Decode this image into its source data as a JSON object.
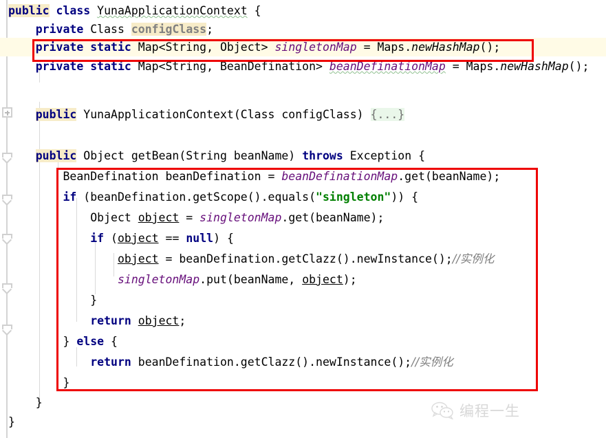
{
  "editor": {
    "language": "Java",
    "class_name": "YunaApplicationContext",
    "theme": {
      "background": "#ffffff",
      "text": "#000000",
      "keyword": "#000080",
      "string": "#008000",
      "field": "#660e7a",
      "comment": "#808080",
      "current_line_bg": "#fffbe6",
      "annotation_box": "#ee0000",
      "identifier_highlight": "#f7ecc8",
      "folded_code_bg": "#eaf7ea",
      "warning_squiggle": "#8fbf8f"
    }
  },
  "gutter": {
    "fold_expand_icon": "+",
    "fold_end_icons": 5
  },
  "code_lines": [
    {
      "n": 1,
      "indent": 0,
      "text": "public class YunaApplicationContext {"
    },
    {
      "n": 2,
      "indent": 1,
      "text": "private Class configClass;"
    },
    {
      "n": 3,
      "indent": 1,
      "text": "private static Map<String, Object> singletonMap = Maps.newHashMap();",
      "highlighted": true
    },
    {
      "n": 4,
      "indent": 1,
      "text": "private static Map<String, BeanDefination> beanDefinationMap = Maps.newHashMap();"
    },
    {
      "n": 5,
      "indent": 0,
      "text": ""
    },
    {
      "n": 6,
      "indent": 1,
      "text": "public YunaApplicationContext(Class configClass) {...}"
    },
    {
      "n": 7,
      "indent": 0,
      "text": ""
    },
    {
      "n": 8,
      "indent": 1,
      "text": "public Object getBean(String beanName) throws Exception {"
    },
    {
      "n": 9,
      "indent": 2,
      "text": "BeanDefination beanDefination = beanDefinationMap.get(beanName);"
    },
    {
      "n": 10,
      "indent": 2,
      "text": "if (beanDefination.getScope().equals(\"singleton\")) {"
    },
    {
      "n": 11,
      "indent": 3,
      "text": "Object object = singletonMap.get(beanName);"
    },
    {
      "n": 12,
      "indent": 3,
      "text": "if (object == null) {"
    },
    {
      "n": 13,
      "indent": 4,
      "text": "object = beanDefination.getClazz().newInstance();//实例化"
    },
    {
      "n": 14,
      "indent": 4,
      "text": "singletonMap.put(beanName, object);"
    },
    {
      "n": 15,
      "indent": 3,
      "text": "}"
    },
    {
      "n": 16,
      "indent": 3,
      "text": "return object;"
    },
    {
      "n": 17,
      "indent": 2,
      "text": "} else {"
    },
    {
      "n": 18,
      "indent": 3,
      "text": "return beanDefination.getClazz().newInstance();//实例化"
    },
    {
      "n": 19,
      "indent": 2,
      "text": "}"
    },
    {
      "n": 20,
      "indent": 1,
      "text": "}"
    },
    {
      "n": 21,
      "indent": 0,
      "text": "}"
    }
  ],
  "annotations": [
    {
      "id": "box-singleton-map-field",
      "label": "red box around the singletonMap static field declaration"
    },
    {
      "id": "box-getbean-body",
      "label": "red box around the getBean method body"
    }
  ],
  "comments": {
    "instantiate": "//实例化"
  },
  "folded_code": "{...}",
  "watermark": {
    "text": "编程一生",
    "icon": "wechat-icon"
  }
}
